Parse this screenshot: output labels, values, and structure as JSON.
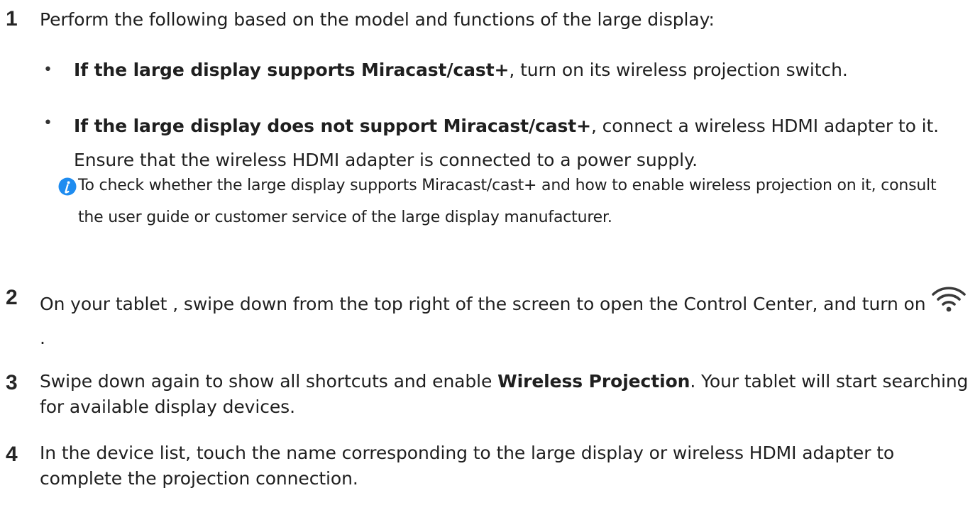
{
  "steps": [
    {
      "number": "1",
      "text": "Perform the following based on the model and functions of the large display:",
      "bullets": [
        {
          "bold": "If the large display supports Miracast/cast+",
          "rest": ", turn on its wireless projection switch."
        },
        {
          "bold": "If the large display does not support Miracast/cast+",
          "rest": ", connect a wireless HDMI adapter to it. Ensure that the wireless HDMI adapter is connected to a power supply."
        }
      ],
      "note": {
        "icon": "info-icon",
        "text": "To check whether the large display supports Miracast/cast+ and how to enable wireless projection on it, consult the user guide or customer service of the large display manufacturer."
      }
    },
    {
      "number": "2",
      "text_before": "On your tablet , swipe down from the top right of the screen to open the Control Center, and turn on",
      "icon": "wifi-icon",
      "text_after": "."
    },
    {
      "number": "3",
      "text_before": "Swipe down again to show all shortcuts and enable ",
      "bold": "Wireless Projection",
      "text_after": ". Your tablet will start searching for available display devices."
    },
    {
      "number": "4",
      "text": "In the device list, touch the name corresponding to the large display or wireless HDMI adapter to complete the projection connection."
    }
  ],
  "colors": {
    "text": "#1f1f1f",
    "info_icon": "#1e8cf0"
  }
}
